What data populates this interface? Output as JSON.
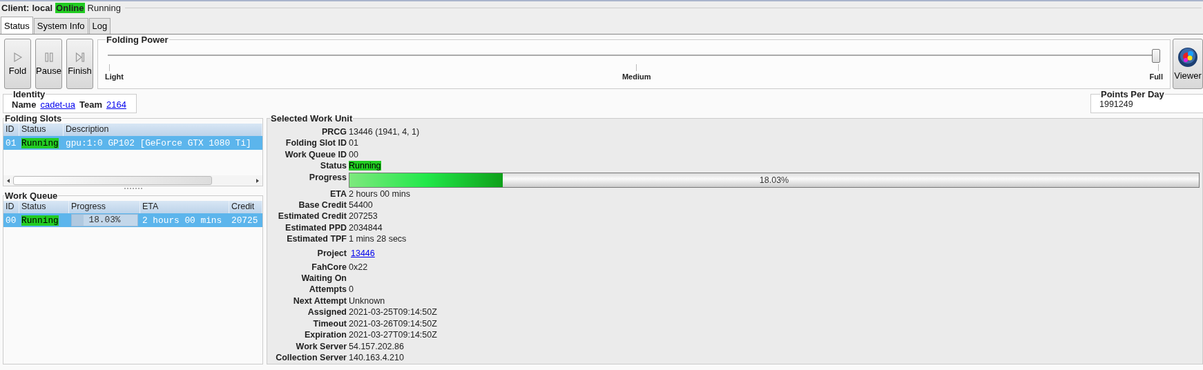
{
  "client": {
    "label": "Client:",
    "name": "local",
    "connection": "Online",
    "online": true,
    "state": "Running"
  },
  "tabs": [
    {
      "label": "Status",
      "selected": true
    },
    {
      "label": "System Info",
      "selected": false
    },
    {
      "label": "Log",
      "selected": false
    }
  ],
  "buttons": [
    {
      "label": "Fold",
      "kind": "play"
    },
    {
      "label": "Pause",
      "kind": "pause"
    },
    {
      "label": "Finish",
      "kind": "finish"
    }
  ],
  "folding_power": {
    "title": "Folding Power",
    "level": 1,
    "ticks": [
      "Light",
      "Medium",
      "Full"
    ]
  },
  "viewer": {
    "label": "Viewer"
  },
  "identity": {
    "title": "Identity",
    "name_label": "Name",
    "name": "cadet-ua",
    "team_label": "Team",
    "team": "2164"
  },
  "points_per_day": {
    "title": "Points Per Day",
    "value": "1991249"
  },
  "folding_slots": {
    "title": "Folding Slots",
    "columns": [
      "ID",
      "Status",
      "Description"
    ],
    "rows": [
      {
        "id": "01",
        "status": "Running",
        "description": "gpu:1:0 GP102 [GeForce GTX 1080 Ti]",
        "selected": true
      }
    ]
  },
  "work_queue": {
    "title": "Work Queue",
    "columns": [
      "ID",
      "Status",
      "Progress",
      "ETA",
      "Credit"
    ],
    "rows": [
      {
        "id": "00",
        "status": "Running",
        "progress": "18.03%",
        "level": 0.1803,
        "eta": "2 hours 00 mins",
        "credit": "20725",
        "selected": true
      }
    ]
  },
  "selected_work_unit": {
    "title": "Selected Work Unit",
    "fields": [
      {
        "label": "PRCG",
        "value": "13446 (1941, 4, 1)",
        "kind": "text"
      },
      {
        "label": "Folding Slot ID",
        "value": "01",
        "kind": "text"
      },
      {
        "label": "Work Queue ID",
        "value": "00",
        "kind": "text"
      },
      {
        "label": "Status",
        "value": "Running",
        "kind": "status"
      },
      {
        "label": "Progress",
        "value": "18.03%",
        "level": 0.1803,
        "kind": "progress"
      },
      {
        "label": "ETA",
        "value": "2 hours 00 mins",
        "kind": "text"
      },
      {
        "label": "Base Credit",
        "value": "54400",
        "kind": "text"
      },
      {
        "label": "Estimated Credit",
        "value": "207253",
        "kind": "text"
      },
      {
        "label": "Estimated PPD",
        "value": "2034844",
        "kind": "text"
      },
      {
        "label": "Estimated TPF",
        "value": "1 mins 28 secs",
        "kind": "text"
      },
      {
        "label": "Project",
        "value": "13446",
        "kind": "link"
      },
      {
        "label": "FahCore",
        "value": "0x22",
        "kind": "text"
      },
      {
        "label": "Waiting On",
        "kind": "text"
      },
      {
        "label": "Attempts",
        "value": "0",
        "kind": "text"
      },
      {
        "label": "Next Attempt",
        "value": "Unknown",
        "kind": "text"
      },
      {
        "label": "Assigned",
        "value": "2021-03-25T09:14:50Z",
        "kind": "text"
      },
      {
        "label": "Timeout",
        "value": "2021-03-26T09:14:50Z",
        "kind": "text"
      },
      {
        "label": "Expiration",
        "value": "2021-03-27T09:14:50Z",
        "kind": "text"
      },
      {
        "label": "Work Server",
        "value": "54.157.202.86",
        "kind": "text"
      },
      {
        "label": "Collection Server",
        "value": "140.163.4.210",
        "kind": "text"
      }
    ]
  }
}
